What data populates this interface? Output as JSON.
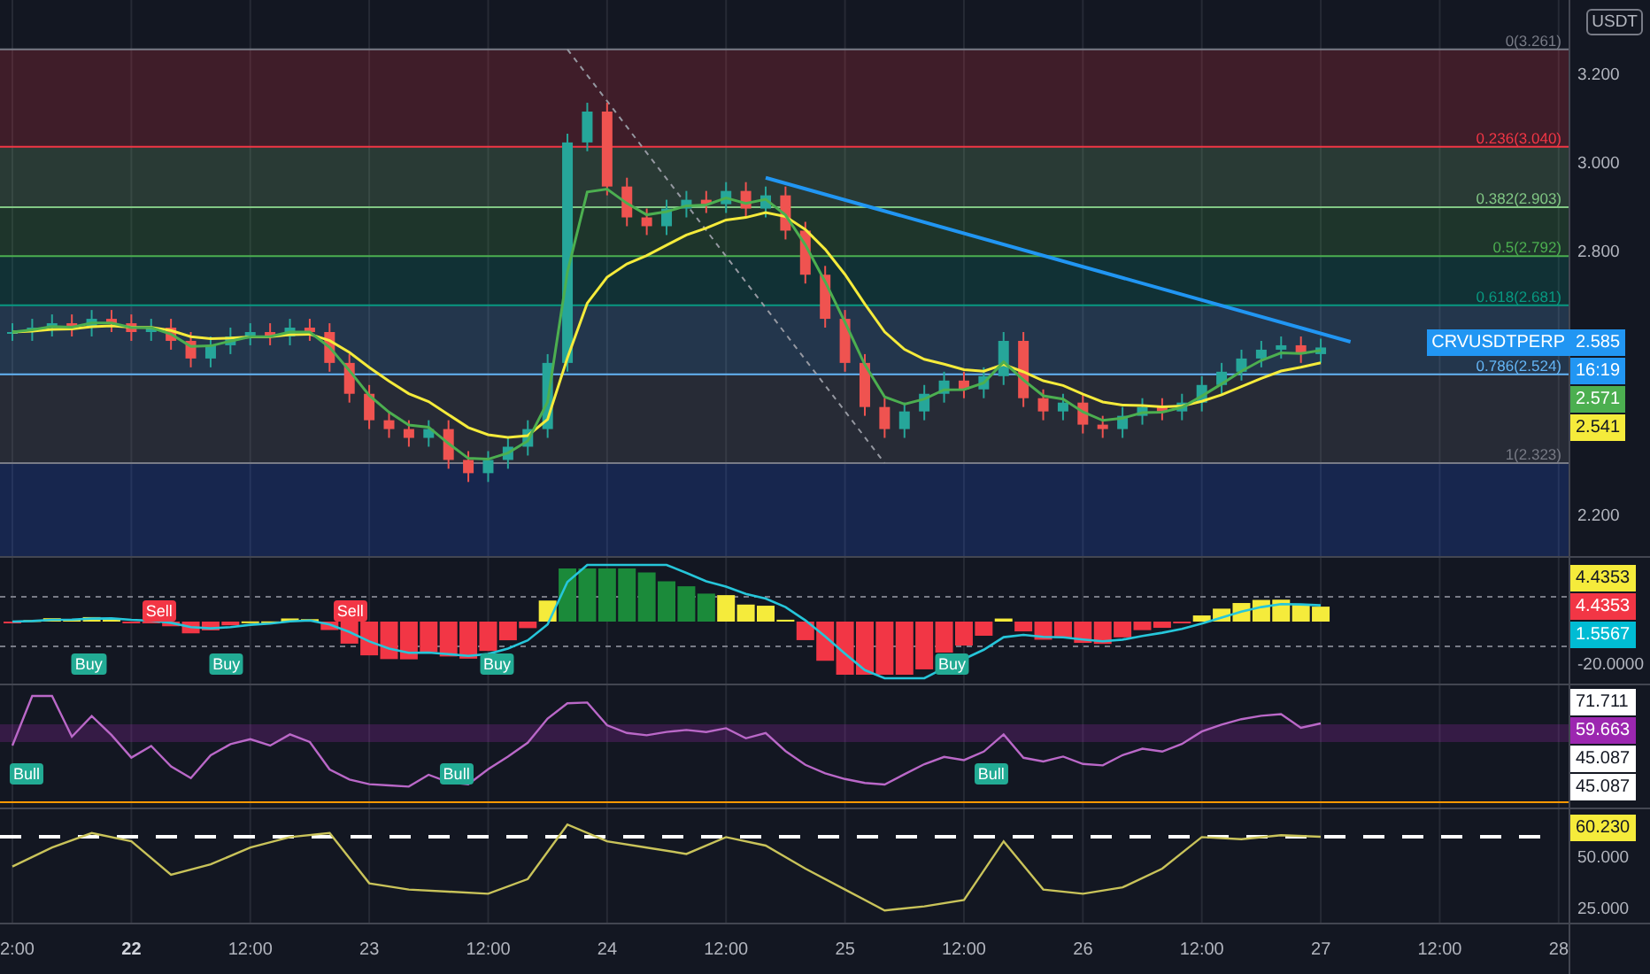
{
  "currency_label": "USDT",
  "panels": [
    {
      "kind": "price",
      "tags": [
        {
          "text": "CRVUSDTPERP",
          "kind": "name",
          "color": "#2196f3"
        },
        {
          "text": "2.585",
          "kind": "value",
          "color": "#2196f3"
        },
        {
          "text": "16:19",
          "kind": "value",
          "color": "#2196f3"
        },
        {
          "text": "2.571",
          "kind": "value",
          "color": "#4caf50"
        },
        {
          "text": "2.541",
          "kind": "value",
          "color": "#f5eb3b"
        }
      ],
      "fib_levels": [
        {
          "label": "0(3.261)",
          "color": "#787b86"
        },
        {
          "label": "0.236(3.040)",
          "color": "#f23645"
        },
        {
          "label": "0.382(2.903)",
          "color": "#81c784"
        },
        {
          "label": "0.5(2.792)",
          "color": "#4caf50"
        },
        {
          "label": "0.618(2.681)",
          "color": "#089981"
        },
        {
          "label": "0.786(2.524)",
          "color": "#64b5f6"
        },
        {
          "label": "1(2.323)",
          "color": "#787b86"
        }
      ],
      "axis_labels": [
        "3.200",
        "3.000",
        "2.800",
        "2.200"
      ]
    },
    {
      "kind": "momentum",
      "tags": [
        {
          "text": "4.4353",
          "kind": "value",
          "color": "#f5eb3b"
        },
        {
          "text": "4.4353",
          "kind": "value",
          "color": "#f23645"
        },
        {
          "text": "1.5567",
          "kind": "value",
          "color": "#00bcd4"
        }
      ],
      "axis_labels": [
        "-20.0000"
      ],
      "markers": [
        {
          "text": "Buy",
          "kind": "buy"
        },
        {
          "text": "Sell",
          "kind": "sell"
        },
        {
          "text": "Buy",
          "kind": "buy"
        },
        {
          "text": "Sell",
          "kind": "sell"
        },
        {
          "text": "Buy",
          "kind": "buy"
        },
        {
          "text": "Buy",
          "kind": "buy"
        }
      ]
    },
    {
      "kind": "oscillator",
      "tags": [
        {
          "text": "71.711",
          "kind": "value",
          "color": "#ffffff"
        },
        {
          "text": "59.663",
          "kind": "value",
          "color": "#9c27b0"
        },
        {
          "text": "45.087",
          "kind": "value",
          "color": "#ffffff"
        },
        {
          "text": "45.087",
          "kind": "value",
          "color": "#ffffff"
        }
      ],
      "markers": [
        {
          "text": "Bull",
          "kind": "bull"
        },
        {
          "text": "Bull",
          "kind": "bull"
        },
        {
          "text": "Bull",
          "kind": "bull"
        }
      ]
    },
    {
      "kind": "line",
      "tags": [
        {
          "text": "60.230",
          "kind": "value",
          "color": "#f5eb3b"
        }
      ],
      "axis_labels": [
        "50.000",
        "25.000"
      ]
    }
  ],
  "time_axis": [
    {
      "text": "2:00",
      "emphasized": false
    },
    {
      "text": "22",
      "emphasized": true
    },
    {
      "text": "12:00",
      "emphasized": false
    },
    {
      "text": "23",
      "emphasized": false
    },
    {
      "text": "12:00",
      "emphasized": false
    },
    {
      "text": "24",
      "emphasized": false
    },
    {
      "text": "12:00",
      "emphasized": false
    },
    {
      "text": "25",
      "emphasized": false
    },
    {
      "text": "12:00",
      "emphasized": false
    },
    {
      "text": "26",
      "emphasized": false
    },
    {
      "text": "12:00",
      "emphasized": false
    },
    {
      "text": "27",
      "emphasized": false
    },
    {
      "text": "12:00",
      "emphasized": false
    },
    {
      "text": "28",
      "emphasized": false
    }
  ]
}
